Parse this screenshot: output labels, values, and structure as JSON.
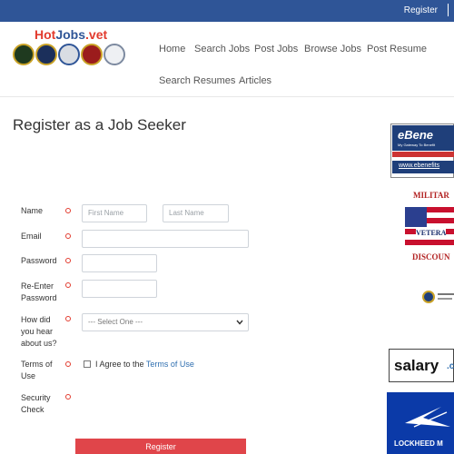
{
  "topbar": {
    "register_label": "Register"
  },
  "logo": {
    "hot": "Hot",
    "jobs": "Jobs",
    "vet": ".vet"
  },
  "nav": {
    "home": "Home",
    "search_jobs": "Search Jobs",
    "post_jobs": "Post Jobs",
    "browse_jobs": "Browse Jobs",
    "post_resume": "Post Resume",
    "search_resumes": "Search Resumes",
    "articles": "Articles"
  },
  "page": {
    "title": "Register as a Job Seeker"
  },
  "form": {
    "name_label": "Name",
    "first_name_placeholder": "First Name",
    "last_name_placeholder": "Last Name",
    "email_label": "Email",
    "password_label": "Password",
    "reenter_label_1": "Re-Enter",
    "reenter_label_2": "Password",
    "hear_label_1": "How did",
    "hear_label_2": "you hear",
    "hear_label_3": "about us?",
    "hear_selected": "--- Select One ---",
    "terms_label_1": "Terms of",
    "terms_label_2": "Use",
    "agree_text": "I Agree to the ",
    "terms_link": "Terms of Use",
    "security_label_1": "Security",
    "security_label_2": "Check",
    "submit_label": "Register"
  },
  "ads": {
    "ebenefits_brand": "eBene",
    "ebenefits_tagline": "My Gateway To Benefit",
    "ebenefits_url": "www.ebenefits",
    "military_top": "MILITAR",
    "military_middle": "VETERA",
    "military_bottom": "DISCOUN",
    "salary": "salary",
    "salary_suffix": ".c",
    "lockheed": "LOCKHEED M"
  },
  "colors": {
    "brand_blue": "#2f5597",
    "accent_red": "#e23b2e",
    "button_red": "#e0454a",
    "link_blue": "#2f6fb0"
  }
}
